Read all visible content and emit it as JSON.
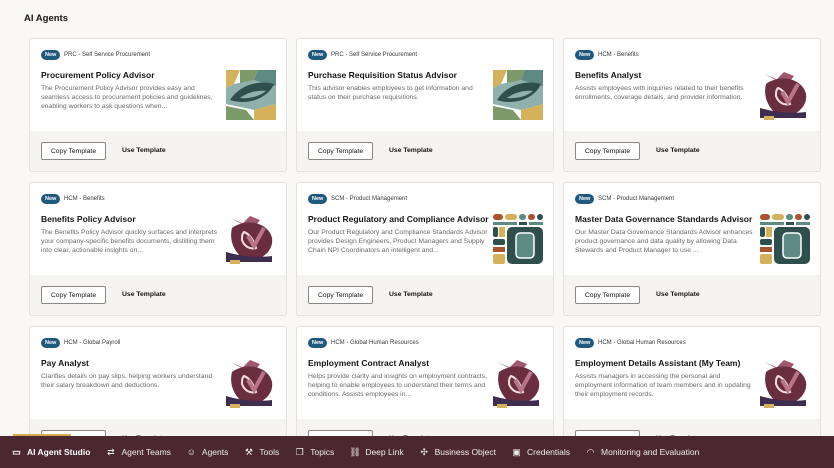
{
  "page_title": "AI Agents",
  "cards": [
    {
      "badge": "New",
      "category": "PRC - Self Service Procurement",
      "name": "Procurement Policy Advisor",
      "description": "The Procurement Policy Advisor provides easy and seamless access to procurement policies and guidelines, enabling workers to ask questions when...",
      "art": "leaf",
      "copy": "Copy Template",
      "use": "Use Template"
    },
    {
      "badge": "New",
      "category": "PRC - Self Service Procurement",
      "name": "Purchase Requisition Status Advisor",
      "description": "This advisor enables employees to get information and status on their purchase requisitions.",
      "art": "leaf",
      "copy": "Copy Template",
      "use": "Use Template"
    },
    {
      "badge": "New",
      "category": "HCM - Benefits",
      "name": "Benefits Analyst",
      "description": "Assists employees with inquiries related to their benefits enrollments, coverage details, and provider information.",
      "art": "heart",
      "copy": "Copy Template",
      "use": "Use Template"
    },
    {
      "badge": "New",
      "category": "HCM - Benefits",
      "name": "Benefits Policy Advisor",
      "description": "The Benefits Policy Advisor quickly surfaces and interprets your company-specific benefits documents, distilling them into clear, actionable insights on...",
      "art": "heart",
      "copy": "Copy Template",
      "use": "Use Template"
    },
    {
      "badge": "New",
      "category": "SCM - Product Management",
      "name": "Product Regulatory and Compliance Advisor",
      "description": "Our Product Regulatory and Compliance Standards Advisor provides Design Engineers, Product Managers and Supply Chain NPI Coordinators an intelligent and...",
      "art": "blocks",
      "copy": "Copy Template",
      "use": "Use Template"
    },
    {
      "badge": "New",
      "category": "SCM - Product Management",
      "name": "Master Data Governance Standards Advisor",
      "description": "Our Master Data Governance Standards Advisor enhances product governance and data quality by allowing Data Stewards and Product Manager to use ...",
      "art": "blocks",
      "copy": "Copy Template",
      "use": "Use Template"
    },
    {
      "badge": "New",
      "category": "HCM - Global Payroll",
      "name": "Pay Analyst",
      "description": "Clarifies details on pay slips, helping workers understand their salary breakdown and deductions.",
      "art": "heart",
      "copy": "Copy Template",
      "use": "Use Template"
    },
    {
      "badge": "New",
      "category": "HCM - Global Human Resources",
      "name": "Employment Contract Analyst",
      "description": "Helps provide clarity and insights on employment contracts, helping to enable employees to understand their terms and conditions. Assists employees in...",
      "art": "heart",
      "copy": "Copy Template",
      "use": "Use Template"
    },
    {
      "badge": "New",
      "category": "HCM - Global Human Resources",
      "name": "Employment Details Assistant (My Team)",
      "description": "Assists managers in accessing the personal and employment information of team members and in updating their employment records.",
      "art": "heart",
      "copy": "Copy Template",
      "use": "Use Template"
    }
  ],
  "nav": [
    {
      "label": "AI Agent Studio",
      "icon": "studio-icon",
      "glyph": "▭",
      "active": true
    },
    {
      "label": "Agent Teams",
      "icon": "agent-teams-icon",
      "glyph": "⇄"
    },
    {
      "label": "Agents",
      "icon": "agents-icon",
      "glyph": "☺"
    },
    {
      "label": "Tools",
      "icon": "tools-icon",
      "glyph": "⚒"
    },
    {
      "label": "Topics",
      "icon": "topics-icon",
      "glyph": "❐"
    },
    {
      "label": "Deep Link",
      "icon": "link-icon",
      "glyph": "⛓"
    },
    {
      "label": "Business Object",
      "icon": "business-object-icon",
      "glyph": "✣"
    },
    {
      "label": "Credentials",
      "icon": "credentials-icon",
      "glyph": "▣"
    },
    {
      "label": "Monitoring and Evaluation",
      "icon": "monitoring-icon",
      "glyph": "◠"
    }
  ]
}
